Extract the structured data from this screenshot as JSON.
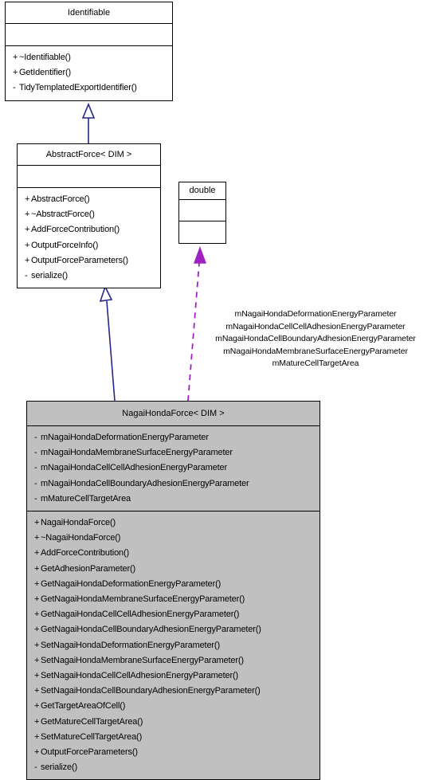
{
  "diagram": {
    "type": "uml-class-diagram",
    "colors": {
      "inheritance_line": "#26268c",
      "association_line": "#a020c0",
      "class_fill_highlight": "#c0c0c0",
      "class_fill_default": "#ffffff",
      "border": "#000000",
      "background": "#ffffff"
    },
    "classes": [
      {
        "id": "identifiable",
        "name": "Identifiable",
        "attributes": [],
        "methods": [
          {
            "visibility": "+",
            "label": "~Identifiable()"
          },
          {
            "visibility": "+",
            "label": "GetIdentifier()"
          },
          {
            "visibility": "-",
            "label": "TidyTemplatedExportIdentifier()"
          }
        ]
      },
      {
        "id": "abstract-force",
        "name": "AbstractForce< DIM >",
        "attributes": [],
        "methods": [
          {
            "visibility": "+",
            "label": "AbstractForce()"
          },
          {
            "visibility": "+",
            "label": "~AbstractForce()"
          },
          {
            "visibility": "+",
            "label": "AddForceContribution()"
          },
          {
            "visibility": "+",
            "label": "OutputForceInfo()"
          },
          {
            "visibility": "+",
            "label": "OutputForceParameters()"
          },
          {
            "visibility": "-",
            "label": "serialize()"
          }
        ]
      },
      {
        "id": "double",
        "name": "double",
        "attributes": [],
        "methods": []
      },
      {
        "id": "nagai-honda-force",
        "name": "NagaiHondaForce< DIM >",
        "attributes": [
          {
            "visibility": "-",
            "label": "mNagaiHondaDeformationEnergyParameter"
          },
          {
            "visibility": "-",
            "label": "mNagaiHondaMembraneSurfaceEnergyParameter"
          },
          {
            "visibility": "-",
            "label": "mNagaiHondaCellCellAdhesionEnergyParameter"
          },
          {
            "visibility": "-",
            "label": "mNagaiHondaCellBoundaryAdhesionEnergyParameter"
          },
          {
            "visibility": "-",
            "label": "mMatureCellTargetArea"
          }
        ],
        "methods": [
          {
            "visibility": "+",
            "label": "NagaiHondaForce()"
          },
          {
            "visibility": "+",
            "label": "~NagaiHondaForce()"
          },
          {
            "visibility": "+",
            "label": "AddForceContribution()"
          },
          {
            "visibility": "+",
            "label": "GetAdhesionParameter()"
          },
          {
            "visibility": "+",
            "label": "GetNagaiHondaDeformationEnergyParameter()"
          },
          {
            "visibility": "+",
            "label": "GetNagaiHondaMembraneSurfaceEnergyParameter()"
          },
          {
            "visibility": "+",
            "label": "GetNagaiHondaCellCellAdhesionEnergyParameter()"
          },
          {
            "visibility": "+",
            "label": "GetNagaiHondaCellBoundaryAdhesionEnergyParameter()"
          },
          {
            "visibility": "+",
            "label": "SetNagaiHondaDeformationEnergyParameter()"
          },
          {
            "visibility": "+",
            "label": "SetNagaiHondaMembraneSurfaceEnergyParameter()"
          },
          {
            "visibility": "+",
            "label": "SetNagaiHondaCellCellAdhesionEnergyParameter()"
          },
          {
            "visibility": "+",
            "label": "SetNagaiHondaCellBoundaryAdhesionEnergyParameter()"
          },
          {
            "visibility": "+",
            "label": "GetTargetAreaOfCell()"
          },
          {
            "visibility": "+",
            "label": "GetMatureCellTargetArea()"
          },
          {
            "visibility": "+",
            "label": "SetMatureCellTargetArea()"
          },
          {
            "visibility": "+",
            "label": "OutputForceParameters()"
          },
          {
            "visibility": "-",
            "label": "serialize()"
          }
        ]
      }
    ],
    "relations": [
      {
        "id": "inherit-identifiable",
        "kind": "inheritance",
        "from": "abstract-force",
        "to": "identifiable",
        "labels": []
      },
      {
        "id": "inherit-abstract-force",
        "kind": "inheritance",
        "from": "nagai-honda-force",
        "to": "abstract-force",
        "labels": []
      },
      {
        "id": "uses-double",
        "kind": "association",
        "from": "nagai-honda-force",
        "to": "double",
        "labels": [
          "mNagaiHondaDeformationEnergyParameter",
          "mNagaiHondaCellCellAdhesionEnergyParameter",
          "mNagaiHondaCellBoundaryAdhesionEnergyParameter",
          "mNagaiHondaMembraneSurfaceEnergyParameter",
          "mMatureCellTargetArea"
        ]
      }
    ]
  }
}
